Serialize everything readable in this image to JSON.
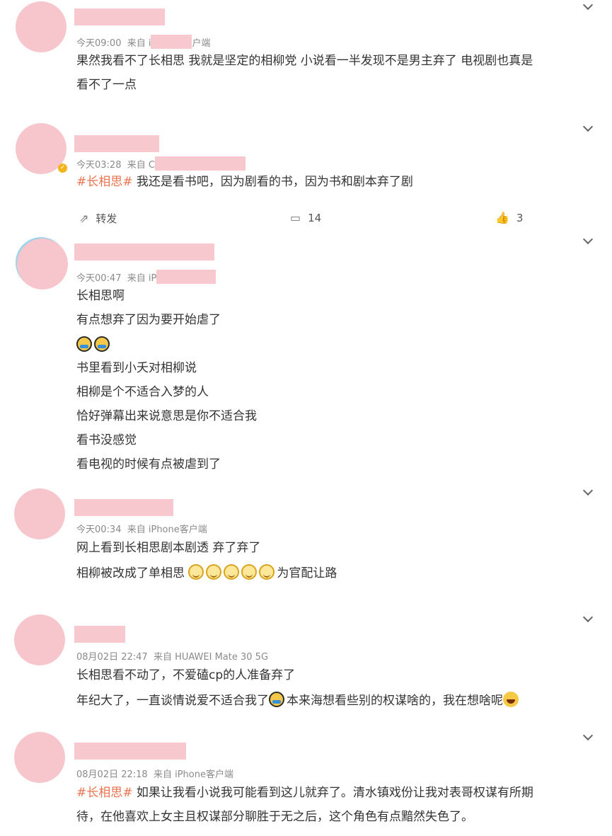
{
  "icons": {
    "expand": "chevron-down-icon",
    "repost": "share-icon",
    "comment": "comment-icon",
    "like": "thumbs-up-icon"
  },
  "colors": {
    "tag": "#eb7350",
    "meta": "#8a8a8a",
    "text": "#333333",
    "redaction": "#f8c8cf",
    "avatar": "#f7c6cc"
  },
  "posts": [
    {
      "time": "今天09:00",
      "source_prefix": "来自 i",
      "source_suffix": "户端",
      "lines": [
        "果然我看不了长相思 我就是坚定的相柳党 小说看一半发现不是男主弃了 电视剧也真是",
        "看不了一点"
      ]
    },
    {
      "time": "今天03:28",
      "source_prefix": "来自 C",
      "tag": "#长相思#",
      "text": " 我还是看书吧，因为剧看的书，因为书和剧本弃了剧",
      "actions": {
        "repost": "转发",
        "comments": "14",
        "likes": "3"
      }
    },
    {
      "time": "今天00:47",
      "source_prefix": "来自 iP",
      "lines": [
        "长相思啊",
        "有点想弃了因为要开始虐了",
        "",
        "书里看到小夭对相柳说",
        "相柳是个不适合入梦的人",
        "恰好弹幕出来说意思是你不适合我",
        "看书没感觉",
        "看电视的时候有点被虐到了"
      ]
    },
    {
      "time": "今天00:34",
      "source": "来自 iPhone客户端",
      "line1": "网上看到长相思剧本剧透 弃了弃了",
      "line2_a": "相柳被改成了单相思",
      "line2_b": "为官配让路"
    },
    {
      "time": "08月02日 22:47",
      "source": "来自 HUAWEI Mate 30 5G",
      "line1": "长相思看不动了，不爱磕cp的人准备弃了",
      "line2_a": "年纪大了，一直谈情说爱不适合我了",
      "line2_b": "本来海想看些别的权谋啥的，我在想啥呢"
    },
    {
      "time": "08月02日 22:18",
      "source": "来自 iPhone客户端",
      "tag": "#长相思#",
      "text": " 如果让我看小说我可能看到这儿就弃了。清水镇戏份让我对表哥权谋有所期",
      "line2": "待，在他喜欢上女主且权谋部分聊胜于无之后，这个角色有点黯然失色了。"
    }
  ]
}
